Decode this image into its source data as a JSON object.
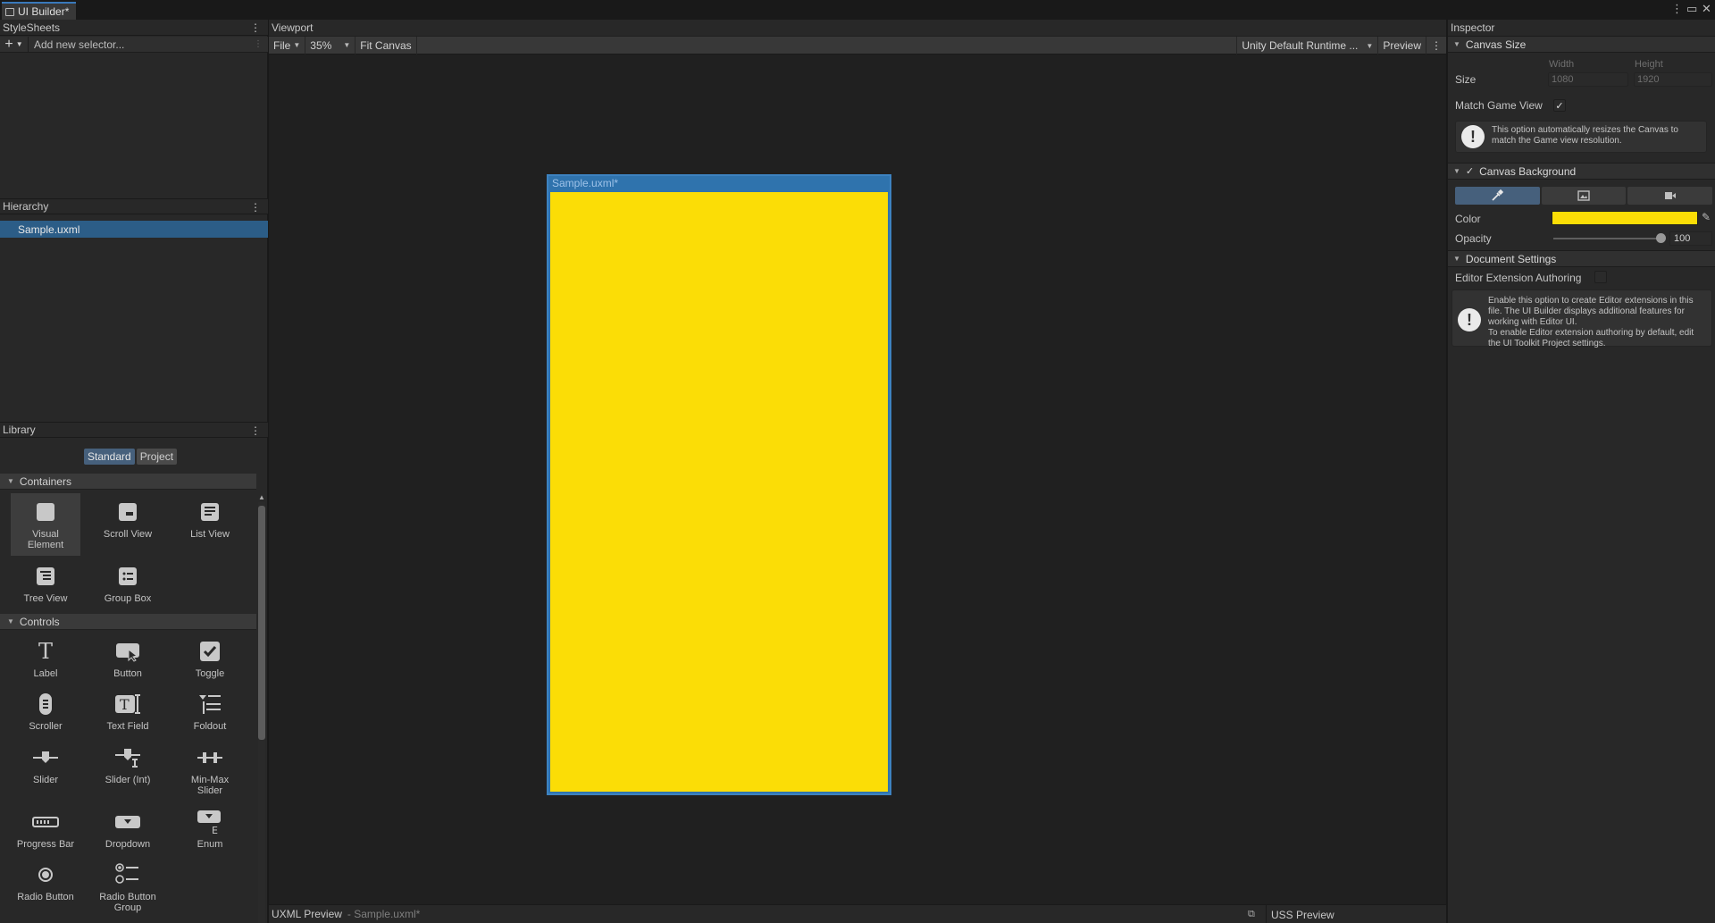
{
  "window": {
    "tab_title": "UI Builder*"
  },
  "stylesheets": {
    "header": "StyleSheets",
    "selector_placeholder": "Add new selector..."
  },
  "hierarchy": {
    "header": "Hierarchy",
    "items": [
      "Sample.uxml"
    ]
  },
  "library": {
    "header": "Library",
    "tabs": [
      "Standard",
      "Project"
    ],
    "active_tab": "Standard",
    "sections": [
      {
        "title": "Containers",
        "items": [
          "Visual\nElement",
          "Scroll View",
          "List View",
          "Tree View",
          "Group Box"
        ]
      },
      {
        "title": "Controls",
        "items": [
          "Label",
          "Button",
          "Toggle",
          "Scroller",
          "Text Field",
          "Foldout",
          "Slider",
          "Slider (Int)",
          "Min-Max\nSlider",
          "Progress Bar",
          "Dropdown",
          "Enum",
          "Radio Button",
          "Radio Button\nGroup"
        ]
      }
    ]
  },
  "viewport": {
    "header": "Viewport",
    "toolbar": {
      "file": "File",
      "zoom": "35%",
      "fit_canvas": "Fit Canvas",
      "theme": "Unity Default Runtime ...",
      "preview": "Preview"
    },
    "canvas_title": "Sample.uxml*",
    "canvas_color": "#FBDD06",
    "bottom": {
      "uxml_preview": "UXML Preview",
      "uxml_file": "-  Sample.uxml*",
      "uss_preview": "USS Preview"
    }
  },
  "inspector": {
    "header": "Inspector",
    "canvas_size": {
      "title": "Canvas Size",
      "size_label": "Size",
      "width_caption": "Width",
      "height_caption": "Height",
      "width": "1080",
      "height": "1920",
      "match_game_view_label": "Match Game View",
      "match_game_view": true,
      "help": "This option automatically resizes the Canvas to match the Game view resolution."
    },
    "canvas_background": {
      "title": "Canvas Background",
      "enabled": true,
      "modes": [
        "color-mode-icon",
        "image-mode-icon",
        "camera-mode-icon"
      ],
      "active_mode": 0,
      "color_label": "Color",
      "color": "#FBDD06",
      "opacity_label": "Opacity",
      "opacity": "100"
    },
    "document_settings": {
      "title": "Document Settings",
      "editor_ext_label": "Editor Extension Authoring",
      "editor_ext": false,
      "help_line1": "Enable this option to create Editor extensions in this file. The UI Builder displays additional features for working with Editor UI.",
      "help_line2": "To enable Editor extension authoring by default, edit the UI Toolkit Project settings."
    }
  }
}
